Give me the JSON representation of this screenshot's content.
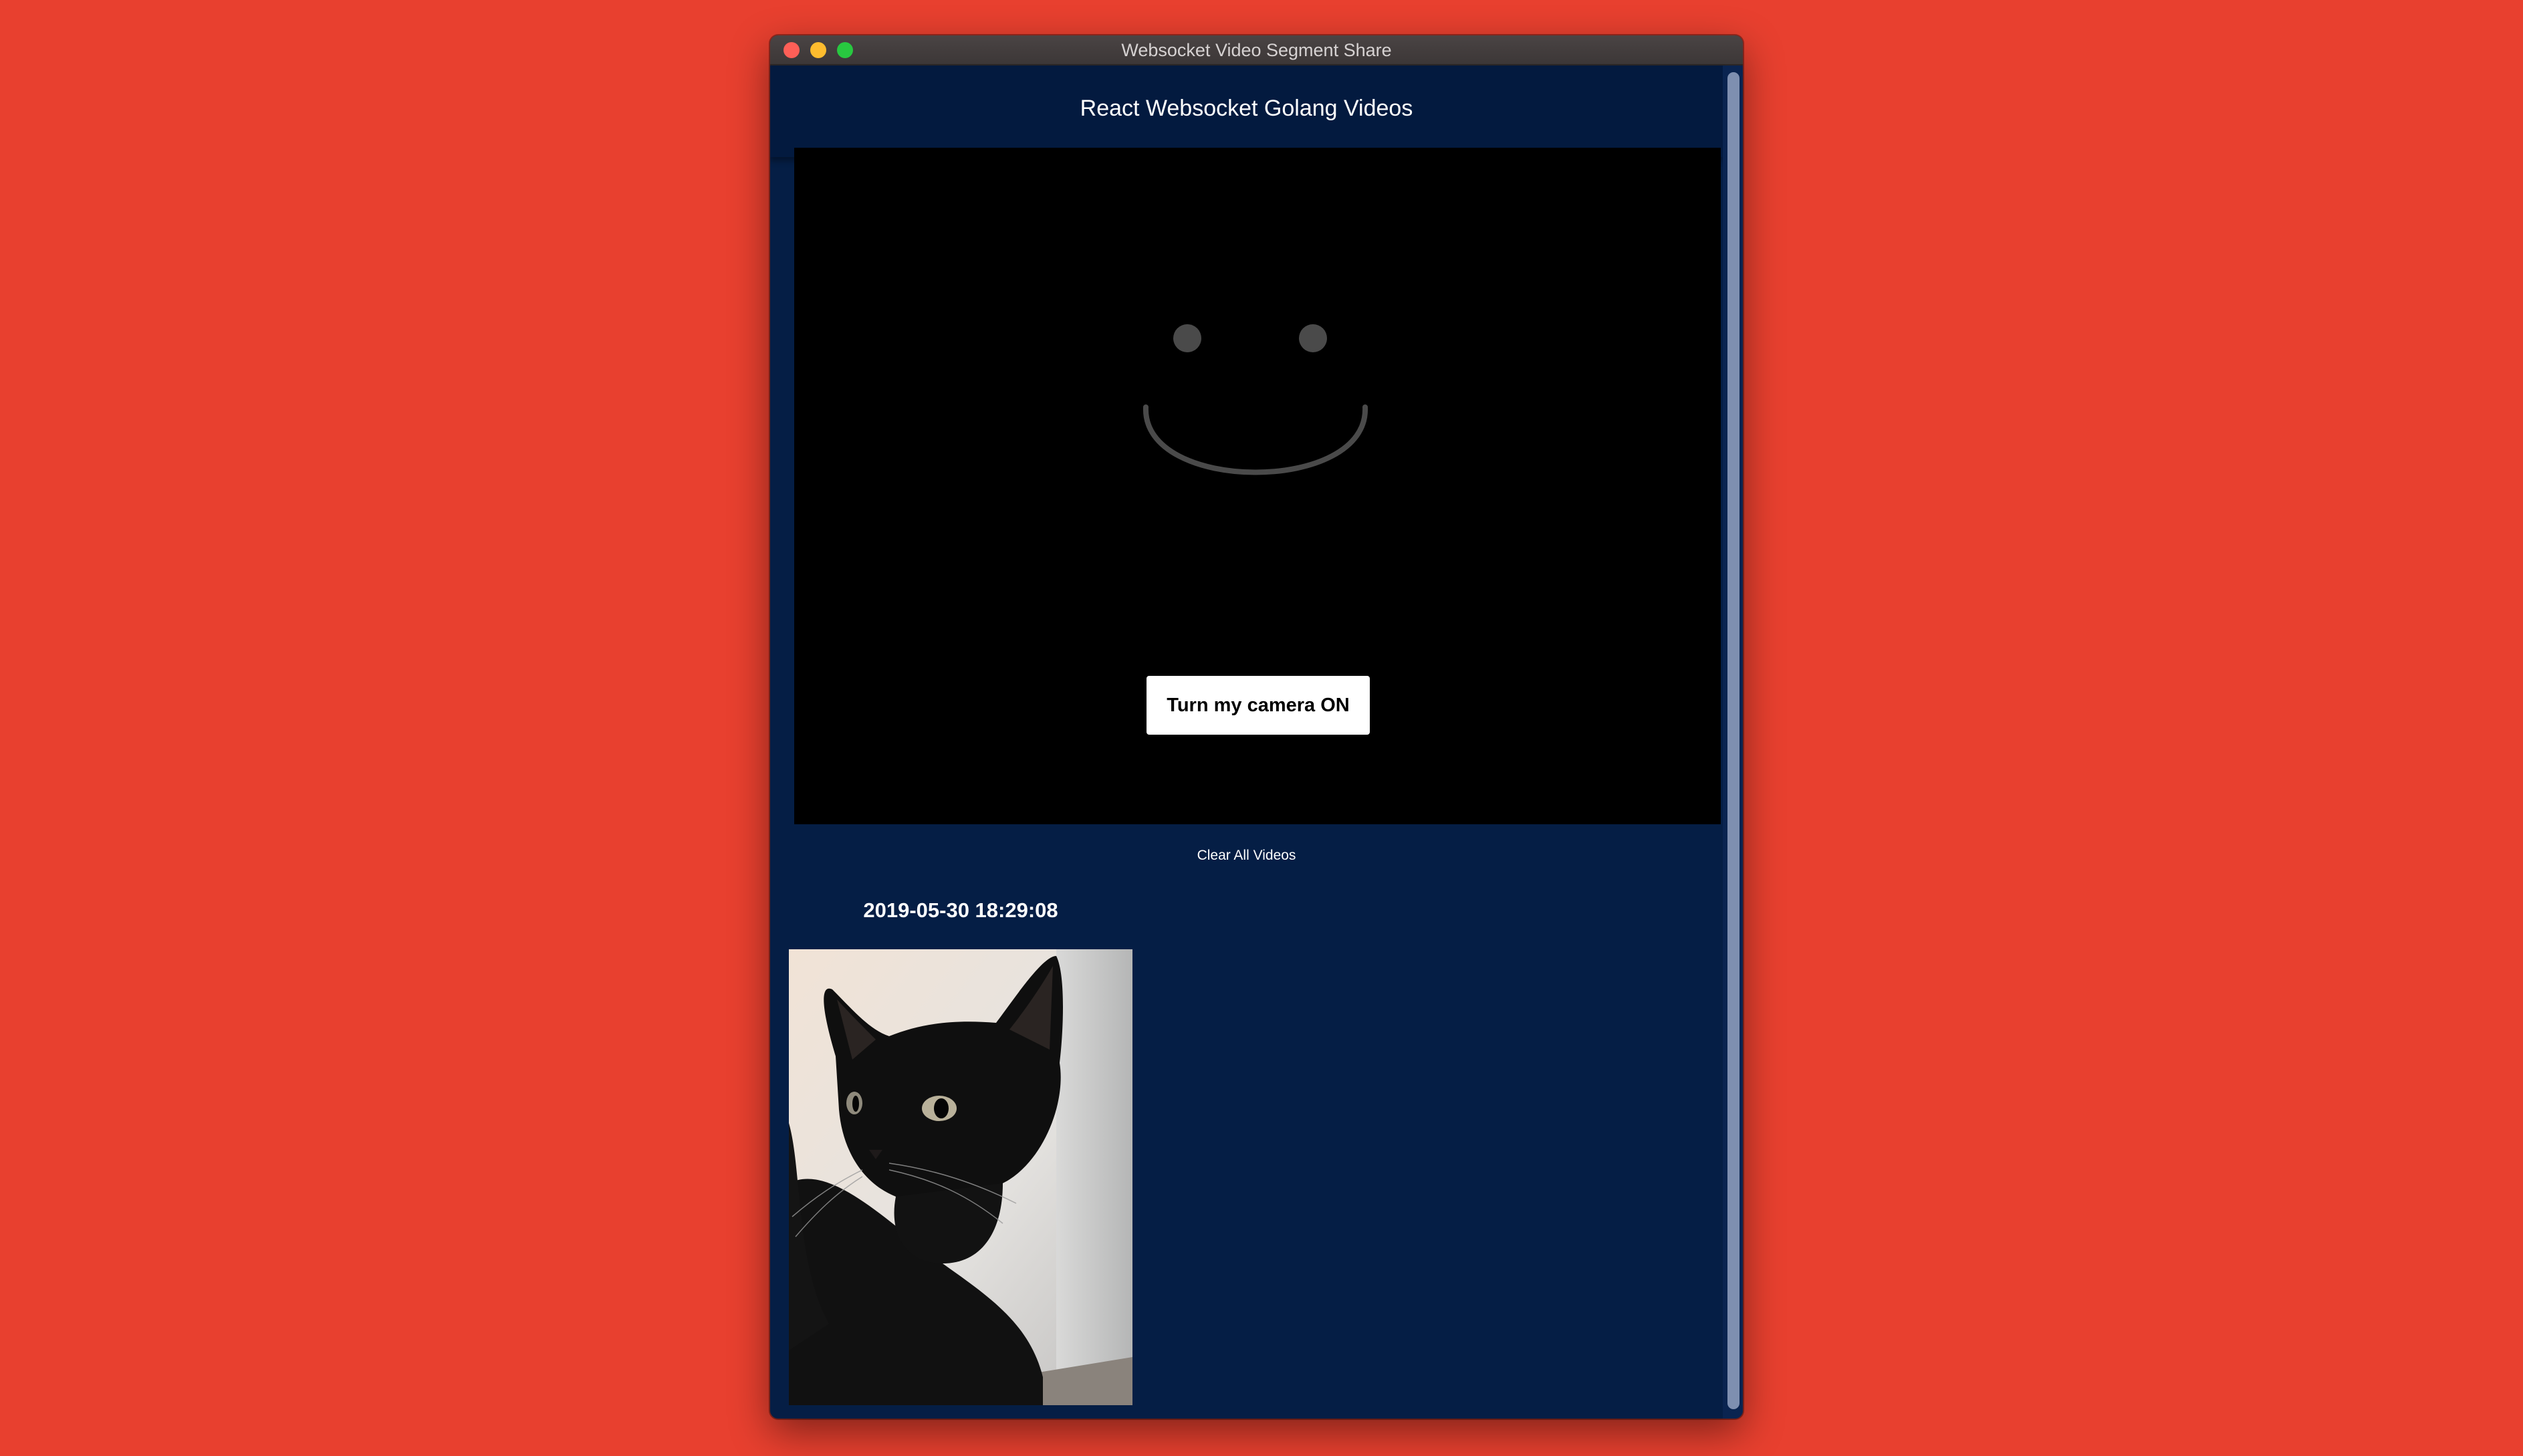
{
  "window": {
    "title": "Websocket Video Segment Share"
  },
  "header": {
    "title": "React Websocket Golang Videos"
  },
  "video_panel": {
    "placeholder_icon": "smiley-face-icon",
    "camera_button_label": "Turn my camera ON"
  },
  "actions": {
    "clear_label": "Clear All Videos"
  },
  "segments": [
    {
      "timestamp": "2019-05-30 18:29:08",
      "thumbnail": "black-cat-photo"
    }
  ],
  "colors": {
    "desktop_background": "#e8402f",
    "app_background": "#051e45",
    "header_background": "#031a3f",
    "video_background": "#000000",
    "smiley_gray": "#4a4a4a"
  }
}
